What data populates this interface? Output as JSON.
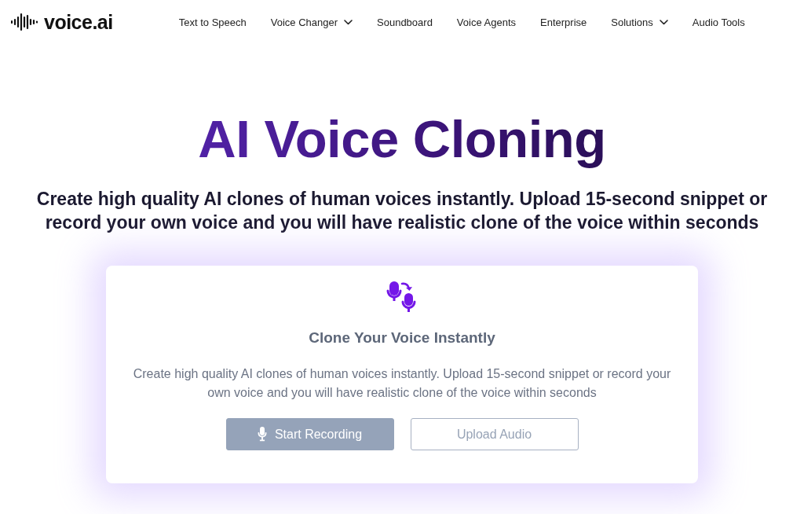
{
  "header": {
    "logo": {
      "text": "voice.ai"
    },
    "nav": [
      {
        "label": "Text to Speech",
        "has_menu": false
      },
      {
        "label": "Voice Changer",
        "has_menu": true
      },
      {
        "label": "Soundboard",
        "has_menu": false
      },
      {
        "label": "Voice Agents",
        "has_menu": false
      },
      {
        "label": "Enterprise",
        "has_menu": false
      },
      {
        "label": "Solutions",
        "has_menu": true
      },
      {
        "label": "Audio Tools",
        "has_menu": false
      }
    ]
  },
  "hero": {
    "title": "AI Voice Cloning",
    "subtitle": "Create high quality AI clones of human voices instantly. Upload 15-second snippet or record your own voice and you will have realistic clone of the voice within seconds"
  },
  "card": {
    "title": "Clone Your Voice Instantly",
    "description": "Create high quality AI clones of human voices instantly. Upload 15-second snippet or record your own voice and you will have realistic clone of the voice within seconds",
    "buttons": [
      {
        "label": "Start Recording",
        "kind": "filled"
      },
      {
        "label": "Upload Audio",
        "kind": "outline"
      }
    ]
  }
}
